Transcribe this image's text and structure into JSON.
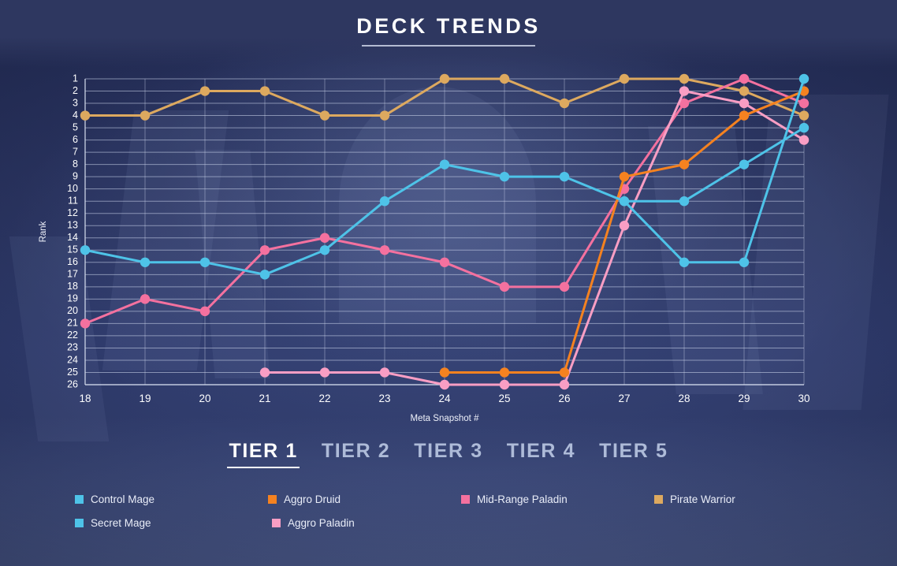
{
  "header": {
    "title": "DECK TRENDS"
  },
  "tiers": [
    {
      "label": "TIER 1",
      "active": true
    },
    {
      "label": "TIER 2",
      "active": false
    },
    {
      "label": "TIER 3",
      "active": false
    },
    {
      "label": "TIER 4",
      "active": false
    },
    {
      "label": "TIER 5",
      "active": false
    }
  ],
  "legend": [
    {
      "label": "Control Mage",
      "color": "#4ec3e8"
    },
    {
      "label": "Aggro Druid",
      "color": "#f58220"
    },
    {
      "label": "Mid-Range Paladin",
      "color": "#f4719f"
    },
    {
      "label": "Pirate Warrior",
      "color": "#dda95f"
    },
    {
      "label": "Secret Mage",
      "color": "#4ec3e8"
    },
    {
      "label": "Aggro Paladin",
      "color": "#f99ec4"
    }
  ],
  "chart_data": {
    "type": "line",
    "title": "DECK TRENDS",
    "xlabel": "Meta Snapshot #",
    "ylabel": "Rank",
    "x": [
      18,
      19,
      20,
      21,
      22,
      23,
      24,
      25,
      26,
      27,
      28,
      29,
      30
    ],
    "xlim": [
      18,
      30
    ],
    "ylim": [
      1,
      26
    ],
    "y_inverted": true,
    "yticks": [
      1,
      2,
      3,
      4,
      5,
      6,
      7,
      8,
      9,
      10,
      11,
      12,
      13,
      14,
      15,
      16,
      17,
      18,
      19,
      20,
      21,
      22,
      23,
      24,
      25,
      26
    ],
    "grid": true,
    "legend_position": "bottom",
    "series": [
      {
        "name": "Control Mage",
        "color": "#4ec3e8",
        "x": [
          18,
          19,
          20,
          21,
          22,
          23,
          24,
          25,
          26,
          27,
          28,
          29,
          30
        ],
        "values": [
          15,
          16,
          16,
          17,
          15,
          11,
          8,
          9,
          9,
          11,
          16,
          16,
          1
        ]
      },
      {
        "name": "Aggro Druid",
        "color": "#f58220",
        "x": [
          24,
          25,
          26,
          27,
          28,
          29,
          30
        ],
        "values": [
          25,
          25,
          25,
          9,
          8,
          4,
          2
        ]
      },
      {
        "name": "Mid-Range Paladin",
        "color": "#f4719f",
        "x": [
          18,
          19,
          20,
          21,
          22,
          23,
          24,
          25,
          26,
          27,
          28,
          29,
          30
        ],
        "values": [
          21,
          19,
          20,
          15,
          14,
          15,
          16,
          18,
          18,
          10,
          3,
          1,
          3
        ]
      },
      {
        "name": "Pirate Warrior",
        "color": "#dda95f",
        "x": [
          18,
          19,
          20,
          21,
          22,
          23,
          24,
          25,
          26,
          27,
          28,
          29,
          30
        ],
        "values": [
          4,
          4,
          2,
          2,
          4,
          4,
          1,
          1,
          3,
          1,
          1,
          2,
          4
        ]
      },
      {
        "name": "Secret Mage",
        "color": "#4ec3e8",
        "x": [
          27,
          28,
          29,
          30
        ],
        "values": [
          11,
          11,
          8,
          5
        ]
      },
      {
        "name": "Aggro Paladin",
        "color": "#f99ec4",
        "x": [
          21,
          22,
          23,
          24,
          25,
          26,
          27,
          28,
          29,
          30
        ],
        "values": [
          25,
          25,
          25,
          26,
          26,
          26,
          13,
          2,
          3,
          6
        ]
      }
    ]
  }
}
